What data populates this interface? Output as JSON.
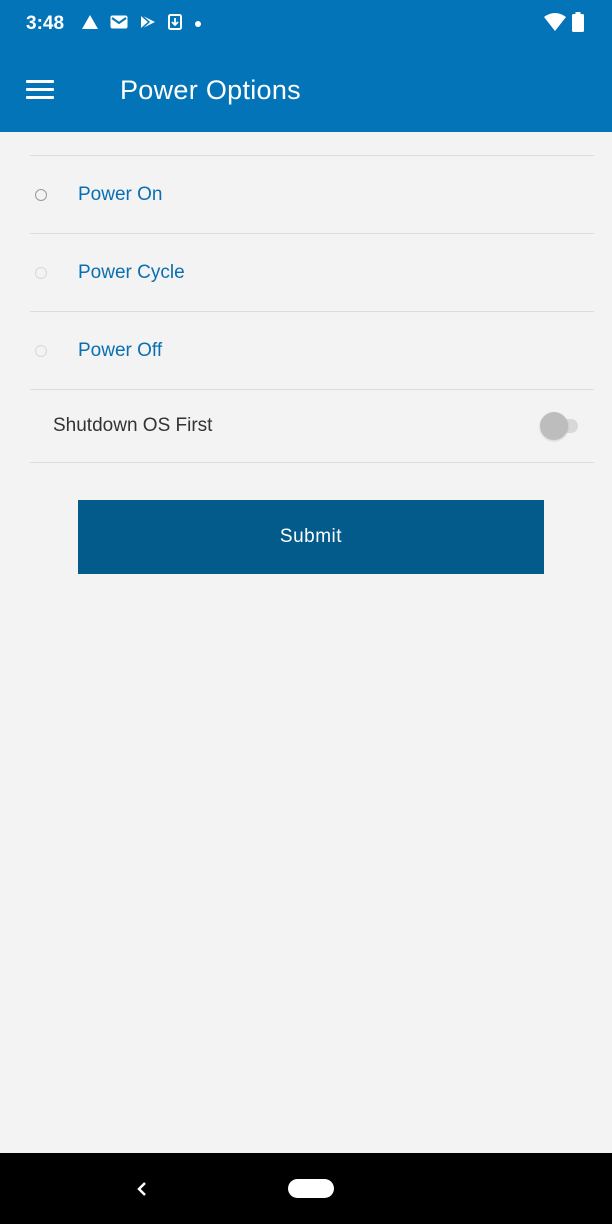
{
  "status_bar": {
    "time": "3:48",
    "icons": [
      "warning-triangle-icon",
      "mail-icon",
      "play-store-icon",
      "download-icon",
      "dot-icon"
    ],
    "right_icons": [
      "wifi-icon",
      "battery-icon"
    ]
  },
  "app_bar": {
    "title": "Power Options",
    "menu_icon": "hamburger-menu-icon"
  },
  "options": [
    {
      "label": "Power On",
      "selected": false
    },
    {
      "label": "Power Cycle",
      "selected": false
    },
    {
      "label": "Power Off",
      "selected": false
    }
  ],
  "toggle": {
    "label": "Shutdown OS First",
    "enabled": false
  },
  "submit": {
    "label": "Submit"
  },
  "nav_bar": {
    "back_icon": "back-chevron-icon",
    "home_icon": "home-pill-icon"
  },
  "colors": {
    "primary": "#0474b9",
    "button": "#025b8b",
    "link": "#0a6fb0",
    "background": "#f3f3f3"
  }
}
